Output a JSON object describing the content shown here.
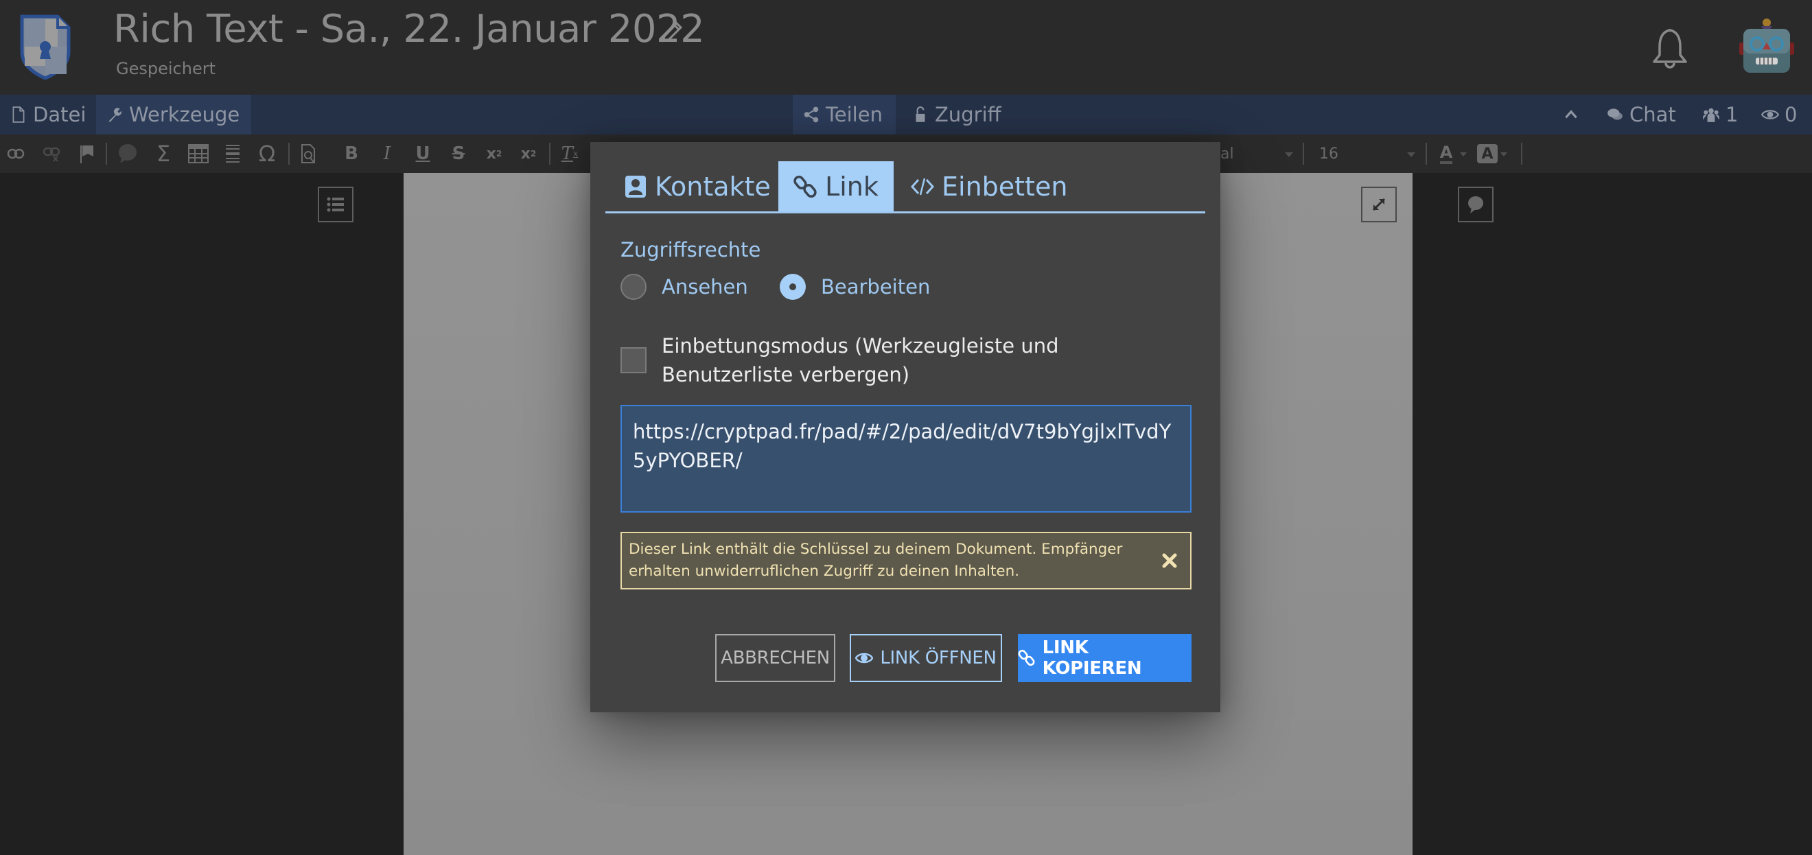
{
  "header": {
    "title": "Rich Text - Sa., 22. Januar 2022",
    "status": "Gespeichert",
    "icons": {
      "logo": "cryptpad-shield-logo",
      "edit": "pencil-icon",
      "notifications": "bell-icon",
      "avatar": "robot-avatar"
    }
  },
  "menubar": {
    "left": [
      {
        "label": "Datei",
        "icon": "file-icon"
      },
      {
        "label": "Werkzeuge",
        "icon": "wrench-icon",
        "active": true
      }
    ],
    "center": [
      {
        "label": "Teilen",
        "icon": "share-icon",
        "active": true
      },
      {
        "label": "Zugriff",
        "icon": "lock-icon"
      }
    ],
    "right": {
      "collapse_icon": "chevron-up-icon",
      "chat_label": "Chat",
      "users_count": "1",
      "viewers_count": "0"
    }
  },
  "toolbar": {
    "buttons": [
      "link",
      "unlink",
      "anchor",
      "comment",
      "math",
      "table",
      "horizontal-rule",
      "special-char",
      "preview",
      "bold",
      "italic",
      "underline",
      "strikethrough",
      "subscript",
      "superscript",
      "remove-format"
    ],
    "font_partial": "al",
    "font_size": "16",
    "text_color_icon": "text-color-icon",
    "bg_color_icon": "background-color-icon"
  },
  "modal": {
    "tabs": [
      {
        "label": "Kontakte",
        "icon": "contacts-icon"
      },
      {
        "label": "Link",
        "icon": "link-icon",
        "active": true
      },
      {
        "label": "Einbetten",
        "icon": "code-icon"
      }
    ],
    "access_label": "Zugriffsrechte",
    "radio_options": [
      {
        "label": "Ansehen",
        "selected": false
      },
      {
        "label": "Bearbeiten",
        "selected": true
      }
    ],
    "embed_mode_label": "Einbettungsmodus (Werkzeugleiste und Benutzerliste verbergen)",
    "embed_mode_checked": false,
    "link_value": "https://cryptpad.fr/pad/#/2/pad/edit/dV7t9bYgjlxlTvdY5yPYOBER/",
    "warning_text": "Dieser Link enthält die Schlüssel zu deinem Dokument. Empfänger erhalten unwiderruflichen Zugriff zu deinen Inhalten.",
    "buttons": {
      "cancel": "ABBRECHEN",
      "open": "LINK ÖFFNEN",
      "copy": "LINK KOPIEREN"
    }
  },
  "colors": {
    "accent_light_blue": "#a6d0f8",
    "primary_blue": "#3587f0",
    "menubar_bg": "#253147",
    "modal_bg": "#424242",
    "warning_bg": "#5d594b",
    "warning_border": "#e6d7a4"
  }
}
